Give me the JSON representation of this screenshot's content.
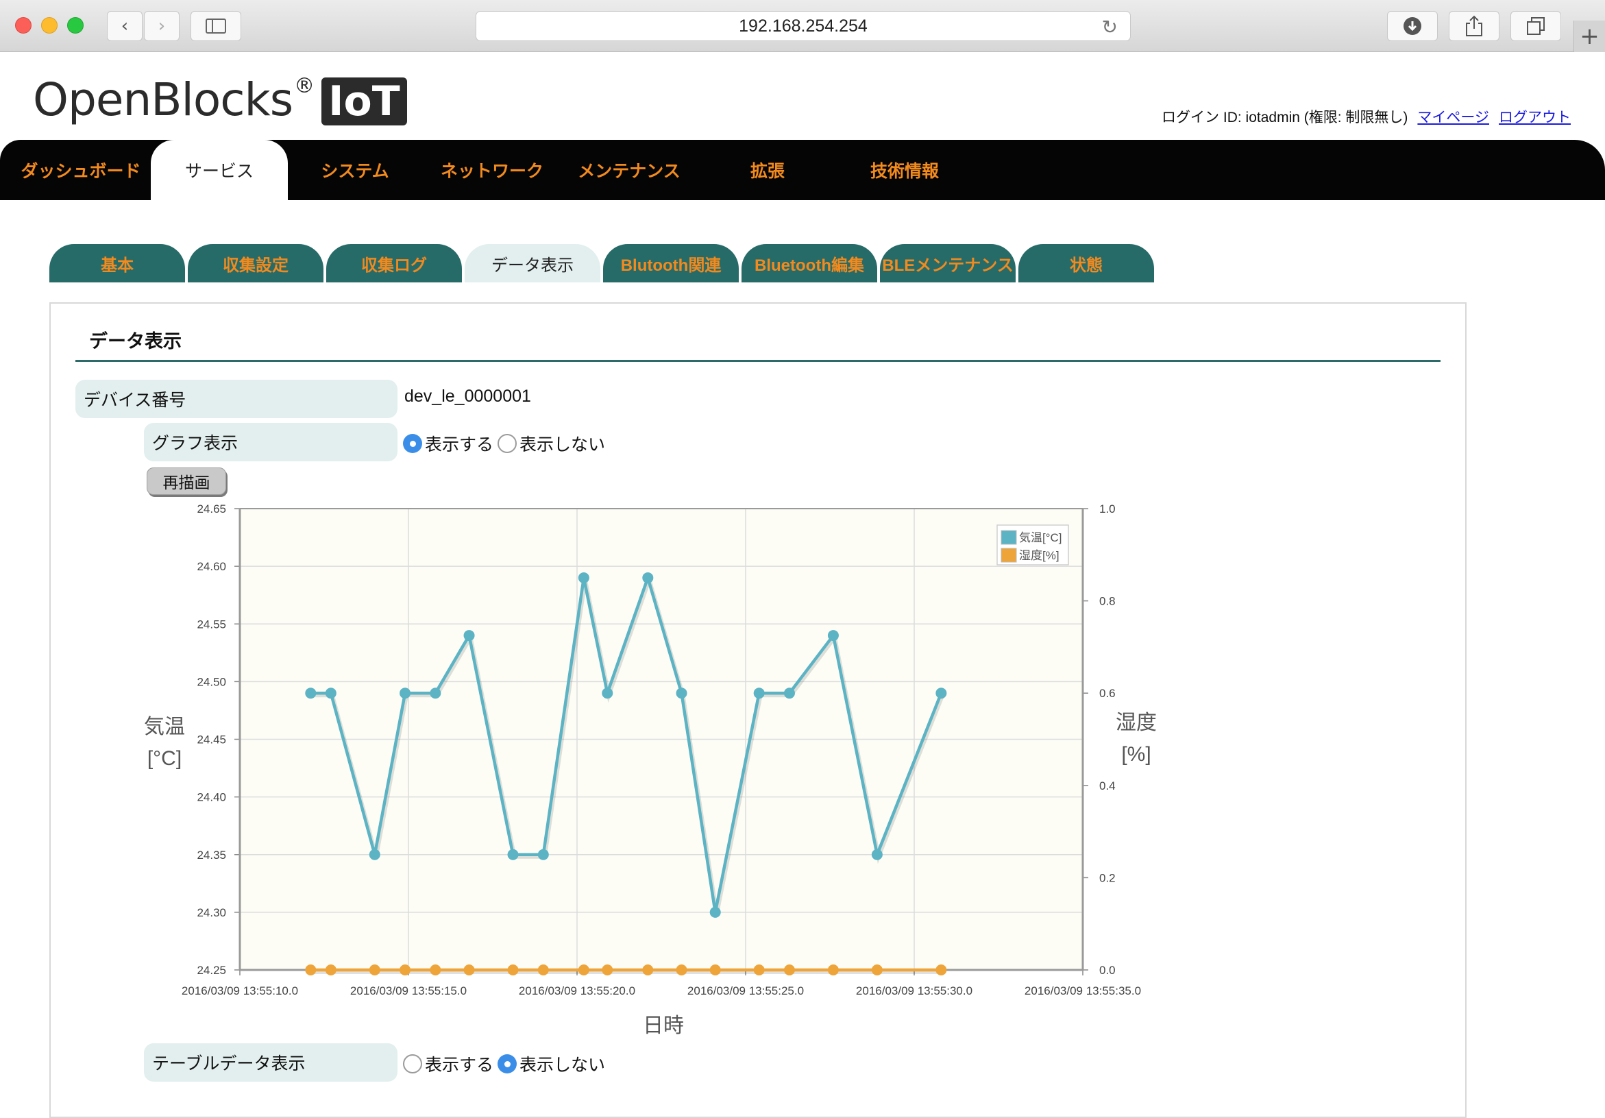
{
  "browser": {
    "url": "192.168.254.254"
  },
  "header": {
    "logo_text": "OpenBlocks",
    "logo_reg": "®",
    "logo_badge": "IoT",
    "login_text": "ログイン ID: iotadmin (権限: 制限無し)",
    "mypage_link": "マイページ",
    "logout_link": "ログアウト"
  },
  "main_nav": [
    {
      "label": "ダッシュボード"
    },
    {
      "label": "サービス",
      "active": true
    },
    {
      "label": "システム"
    },
    {
      "label": "ネットワーク"
    },
    {
      "label": "メンテナンス"
    },
    {
      "label": "拡張"
    },
    {
      "label": "技術情報"
    }
  ],
  "sub_tabs": [
    {
      "label": "基本"
    },
    {
      "label": "収集設定"
    },
    {
      "label": "収集ログ"
    },
    {
      "label": "データ表示",
      "active": true
    },
    {
      "label": "Blutooth関連"
    },
    {
      "label": "Bluetooth編集"
    },
    {
      "label": "BLEメンテナンス"
    },
    {
      "label": "状態"
    }
  ],
  "section": {
    "title": "データ表示",
    "device_label": "デバイス番号",
    "device_value": "dev_le_0000001",
    "graph_label": "グラフ表示",
    "graph_show": "表示する",
    "graph_hide": "表示しない",
    "graph_selected": "show",
    "redraw_button": "再描画",
    "table_label": "テーブルデータ表示",
    "table_show": "表示する",
    "table_hide": "表示しない",
    "table_selected": "hide"
  },
  "chart_data": {
    "type": "line",
    "xlabel": "日時",
    "ylabel_left": "気温 [°C]",
    "ylabel_right": "湿度 [%]",
    "x_ticks": [
      "2016/03/09 13:55:10.0",
      "2016/03/09 13:55:15.0",
      "2016/03/09 13:55:20.0",
      "2016/03/09 13:55:25.0",
      "2016/03/09 13:55:30.0",
      "2016/03/09 13:55:35.0"
    ],
    "xlim_seconds": [
      10,
      35
    ],
    "ylim_left": [
      24.25,
      24.65
    ],
    "yticks_left": [
      "24.25",
      "24.30",
      "24.35",
      "24.40",
      "24.45",
      "24.50",
      "24.55",
      "24.60",
      "24.65"
    ],
    "ylim_right": [
      0.0,
      1.0
    ],
    "yticks_right": [
      "0.0",
      "0.2",
      "0.4",
      "0.6",
      "0.8",
      "1.0"
    ],
    "legend_position": "top-right",
    "grid": true,
    "series": [
      {
        "name": "気温[°C]",
        "axis": "left",
        "color": "#5bb3c4",
        "x_seconds": [
          12.1,
          12.7,
          14.0,
          14.9,
          15.8,
          16.8,
          18.1,
          19.0,
          20.2,
          20.9,
          22.1,
          23.1,
          24.1,
          25.4,
          26.3,
          27.6,
          28.9,
          30.8
        ],
        "values": [
          24.49,
          24.49,
          24.35,
          24.49,
          24.49,
          24.54,
          24.35,
          24.35,
          24.59,
          24.49,
          24.59,
          24.49,
          24.3,
          24.49,
          24.49,
          24.54,
          24.35,
          24.49
        ]
      },
      {
        "name": "湿度[%]",
        "axis": "right",
        "color": "#eea438",
        "x_seconds": [
          12.1,
          12.7,
          14.0,
          14.9,
          15.8,
          16.8,
          18.1,
          19.0,
          20.2,
          20.9,
          22.1,
          23.1,
          24.1,
          25.4,
          26.3,
          27.6,
          28.9,
          30.8
        ],
        "values": [
          0,
          0,
          0,
          0,
          0,
          0,
          0,
          0,
          0,
          0,
          0,
          0,
          0,
          0,
          0,
          0,
          0,
          0
        ]
      }
    ]
  }
}
